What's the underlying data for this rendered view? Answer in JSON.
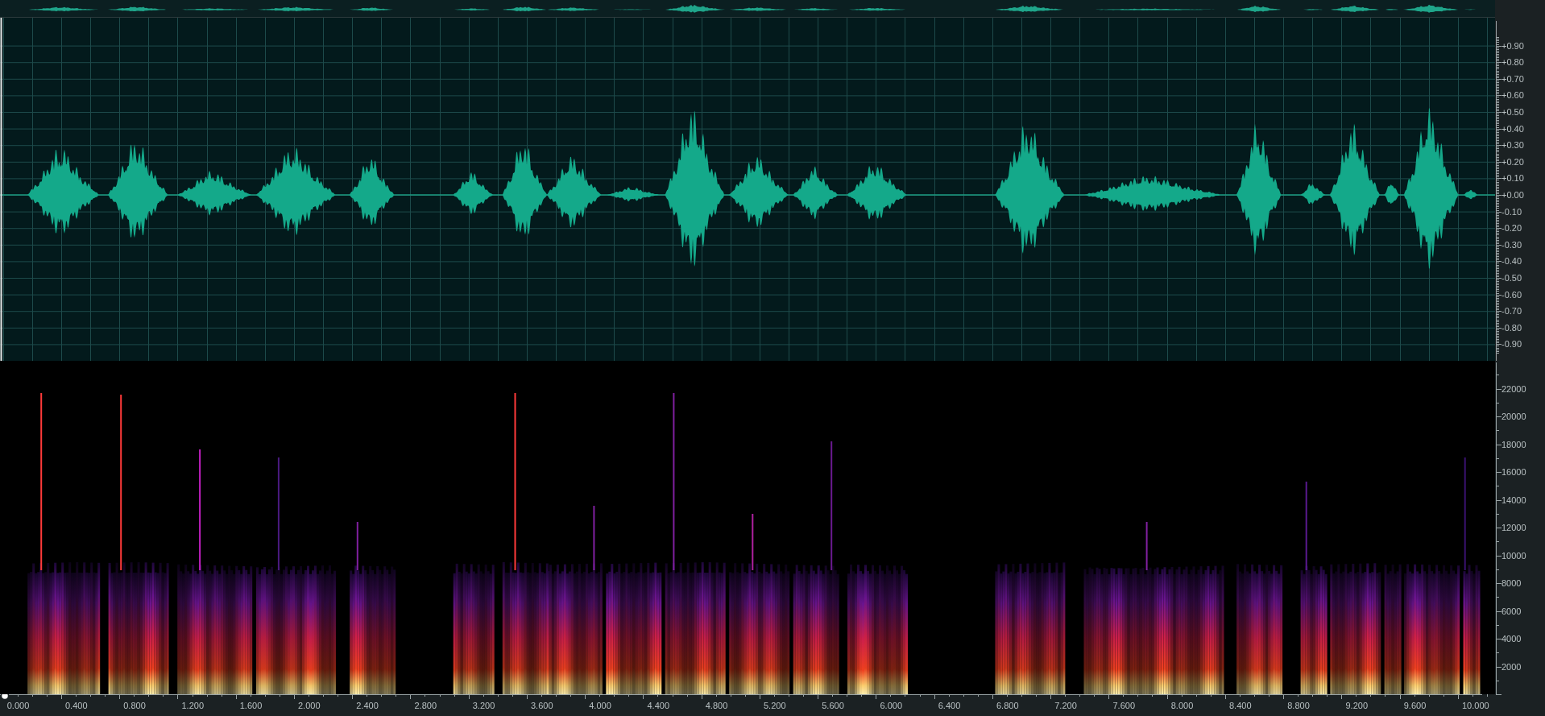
{
  "amplitude_axis": {
    "labels": [
      "+0.90",
      "+0.80",
      "+0.70",
      "+0.60",
      "+0.50",
      "+0.40",
      "+0.30",
      "+0.20",
      "+0.10",
      "+0.00",
      "-0.10",
      "-0.20",
      "-0.30",
      "-0.40",
      "-0.50",
      "-0.60",
      "-0.70",
      "-0.80",
      "-0.90"
    ]
  },
  "frequency_axis": {
    "labels": [
      "22000",
      "20000",
      "18000",
      "16000",
      "14000",
      "12000",
      "10000",
      "8000",
      "6000",
      "4000",
      "2000"
    ]
  },
  "time_axis": {
    "labels": [
      "0.000",
      "0.400",
      "0.800",
      "1.200",
      "1.600",
      "2.000",
      "2.400",
      "2.800",
      "3.200",
      "3.600",
      "4.000",
      "4.400",
      "4.800",
      "5.200",
      "5.600",
      "6.000",
      "6.400",
      "6.800",
      "7.200",
      "7.600",
      "8.000",
      "8.400",
      "8.800",
      "9.200",
      "9.600",
      "10.000"
    ]
  }
}
